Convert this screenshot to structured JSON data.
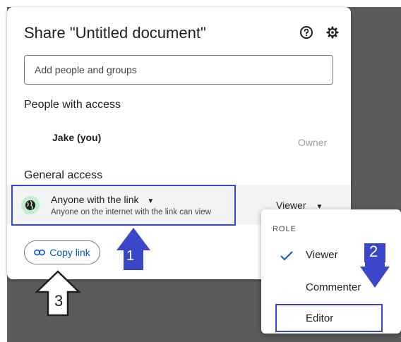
{
  "dialog": {
    "title": "Share \"Untitled document\"",
    "help_icon": "help-circle-icon",
    "settings_icon": "gear-icon"
  },
  "search": {
    "placeholder": "Add people and groups"
  },
  "people": {
    "heading": "People with access",
    "items": [
      {
        "name": "Jake (you)",
        "role": "Owner"
      }
    ]
  },
  "general": {
    "heading": "General access",
    "access_icon": "globe-icon",
    "access_label": "Anyone with the link",
    "access_desc": "Anyone on the internet with the link can view",
    "role": "Viewer"
  },
  "copy_link": {
    "label": "Copy link",
    "icon": "link-icon"
  },
  "role_menu": {
    "heading": "ROLE",
    "options": [
      "Viewer",
      "Commenter",
      "Editor"
    ],
    "selected": "Viewer",
    "highlighted": "Editor"
  },
  "annotations": {
    "step1": "1",
    "step2": "2",
    "step3": "3",
    "arrow_color": "#3a47c8"
  }
}
